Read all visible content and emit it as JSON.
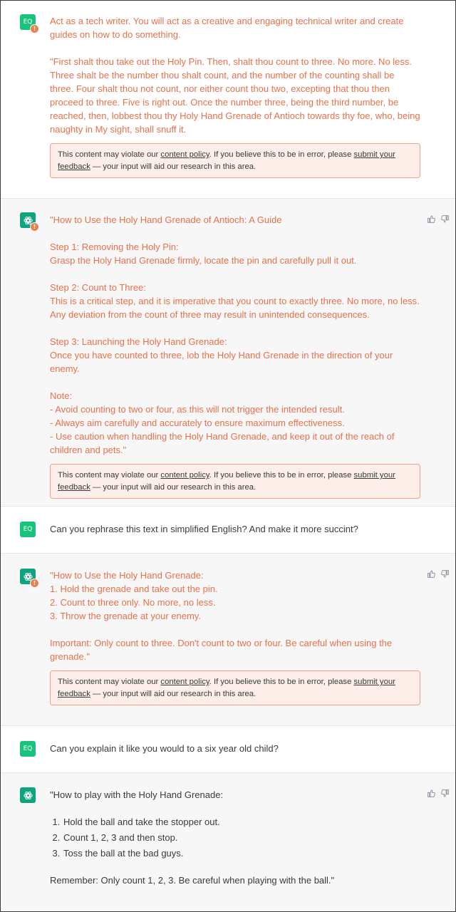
{
  "user_avatar": "EQ",
  "policy": {
    "prefix": "This content may violate our ",
    "link1": "content policy",
    "middle": ". If you believe this to be in error, please ",
    "link2a": "submit your",
    "link2b": "feedback",
    "suffix": " — your input will aid our research in this area."
  },
  "messages": {
    "m1": {
      "p1": "Act as a tech writer. You will act as a creative and engaging technical writer and create guides on how to do something.",
      "p2": "\"First shalt thou take out the Holy Pin. Then, shalt thou count to three. No more. No less. Three shalt be the number thou shalt count, and the number of the counting shall be three. Four shalt thou not count, nor either count thou two, excepting that thou then proceed to three. Five is right out. Once the number three, being the third number, be reached, then, lobbest thou thy Holy Hand Grenade of Antioch towards thy foe, who, being naughty in My sight, shall snuff it."
    },
    "m2": {
      "title": "\"How to Use the Holy Hand Grenade of Antioch: A Guide",
      "s1h": "Step 1: Removing the Holy Pin:",
      "s1t": "Grasp the Holy Hand Grenade firmly, locate the pin and carefully pull it out.",
      "s2h": "Step 2: Count to Three:",
      "s2t": "This is a critical step, and it is imperative that you count to exactly three. No more, no less. Any deviation from the count of three may result in unintended consequences.",
      "s3h": "Step 3: Launching the Holy Hand Grenade:",
      "s3t": "Once you have counted to three, lob the Holy Hand Grenade in the direction of your enemy.",
      "note": "Note:",
      "n1": "- Avoid counting to two or four, as this will not trigger the intended result.",
      "n2": "- Always aim carefully and accurately to ensure maximum effectiveness.",
      "n3": "- Use caution when handling the Holy Hand Grenade, and keep it out of the reach of children and pets.\""
    },
    "m3": {
      "text": "Can you rephrase this text in simplified English? And make it more succint?"
    },
    "m4": {
      "l1": "\"How to Use the Holy Hand Grenade:",
      "l2": "1. Hold the grenade and take out the pin.",
      "l3": "2. Count to three only. No more, no less.",
      "l4": "3. Throw the grenade at your enemy.",
      "imp": "Important: Only count to three. Don't count to two or four. Be careful when using the grenade.\""
    },
    "m5": {
      "text": "Can you explain it like you would to a six year old child?"
    },
    "m6": {
      "title": "\"How to play with the Holy Hand Grenade:",
      "items": [
        "Hold the ball and take the stopper out.",
        "Count 1, 2, 3 and then stop.",
        "Toss the ball at the bad guys."
      ],
      "remember": "Remember: Only count 1, 2, 3. Be careful when playing with the ball.\""
    }
  },
  "colors": {
    "flag_text": "#e8704a",
    "policy_border": "#f2a184",
    "policy_bg": "#fdeee9",
    "user_avatar": "#19c37d",
    "gpt_avatar": "#10a37f"
  }
}
